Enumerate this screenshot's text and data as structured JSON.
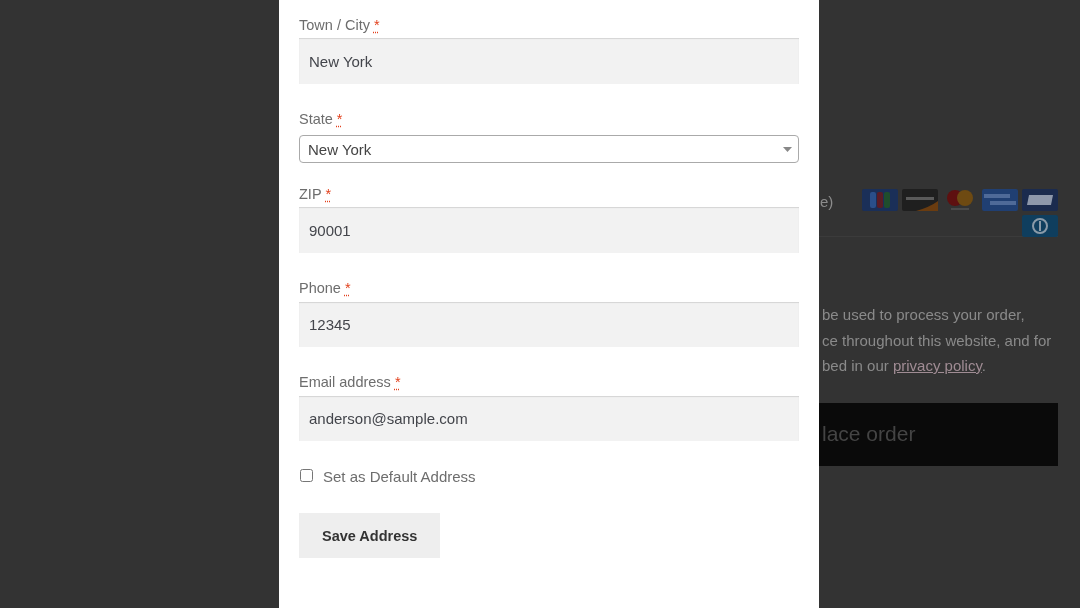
{
  "modal": {
    "fields": [
      {
        "kind": "text",
        "label": "Town / City",
        "required_mark": "*",
        "value": "New York"
      },
      {
        "kind": "select",
        "label": "State",
        "required_mark": "*",
        "value": "New York"
      },
      {
        "kind": "text",
        "label": "ZIP",
        "required_mark": "*",
        "value": "90001"
      },
      {
        "kind": "text",
        "label": "Phone",
        "required_mark": "*",
        "value": "12345"
      },
      {
        "kind": "text",
        "label": "Email address",
        "required_mark": "*",
        "value": "anderson@sample.com"
      }
    ],
    "default_checkbox": {
      "label": "Set as Default Address",
      "checked": false
    },
    "save_button": "Save Address"
  },
  "background_page": {
    "payment_row": {
      "text": "e)",
      "card_logos": [
        {
          "kind": "jcb"
        },
        {
          "kind": "discover"
        },
        {
          "kind": "mastercard"
        },
        {
          "kind": "amex"
        },
        {
          "kind": "visa"
        },
        {
          "kind": "diners"
        }
      ]
    },
    "privacy_notice": {
      "lines": [
        "be used to process your order,",
        "ce throughout this website, and for"
      ],
      "last_line": {
        "before": "bed in our ",
        "link": "privacy policy",
        "after": "."
      }
    },
    "place_order_button": "lace order"
  }
}
